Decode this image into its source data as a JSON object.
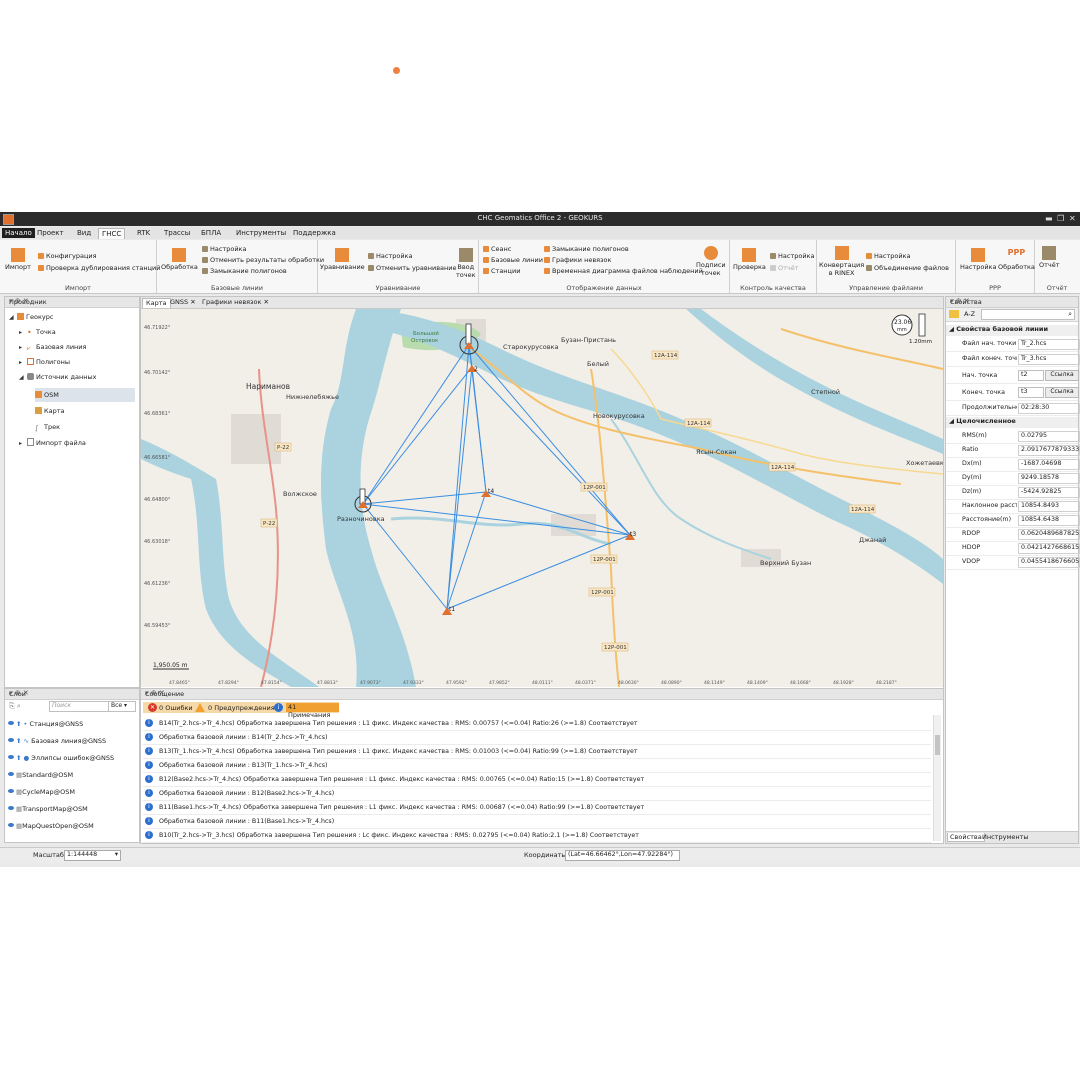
{
  "window": {
    "title": "CHC Geomatics Office 2 - GEOKURS"
  },
  "menu": {
    "items": [
      "Начало",
      "Проект",
      "Вид",
      "ГНСС",
      "RTK",
      "Трассы",
      "БПЛА",
      "Инструменты",
      "Поддержка"
    ],
    "active": "ГНСС"
  },
  "ribbon": {
    "import": {
      "label": "Импорт",
      "big": "Импорт",
      "config": "Конфигурация",
      "dup": "Проверка дублирования станций"
    },
    "baselines": {
      "label": "Базовые линии",
      "big": "Обработка",
      "settings": "Настройка",
      "undo": "Отменить результаты обработки",
      "closure": "Замыкание полигонов"
    },
    "adjust": {
      "label": "Уравнивание",
      "big": "Уравнивание",
      "settings": "Настройка",
      "undo": "Отменить уравнивание",
      "input_line1": "Ввод",
      "input_line2": "точек"
    },
    "display": {
      "label": "Отображение данных",
      "session": "Сеанс",
      "baselines": "Базовые линии",
      "stations": "Станции",
      "closure": "Замыкание полигонов",
      "vectors": "Графики невязок",
      "timeline": "Временная диаграмма файлов наблюдений",
      "captions_line1": "Подписи",
      "captions_line2": "точек"
    },
    "qc": {
      "label": "Контроль качества",
      "check": "Проверка",
      "settings": "Настройка",
      "report": "Отчёт"
    },
    "files": {
      "label": "Управление файлами",
      "convert_line1": "Конвертация",
      "convert_line2": "в RINEX",
      "settings": "Настройка",
      "merge": "Объединение файлов"
    },
    "ppp": {
      "label": "PPP",
      "settings": "Настройка",
      "processing": "Обработка",
      "logo": "PPP"
    },
    "report": {
      "label": "Отчёт",
      "big": "Отчёт"
    }
  },
  "explorer": {
    "title": "Проводник",
    "items": [
      "Геокурс",
      "Точка",
      "Базовая линия",
      "Полигоны",
      "Источник данных",
      "OSM",
      "Карта",
      "Трек",
      "Импорт файла"
    ]
  },
  "map_tabs": [
    "Карта",
    "GNSS",
    "Графики невязок"
  ],
  "map": {
    "labels": {
      "narimanov": "Нариманов",
      "nizhnelebyazhye": "Нижнелебяжье",
      "starokurus": "Старокурусовка",
      "buzan": "Бузан-Пристань",
      "belyi": "Белый",
      "novokurus": "Новокурусовка",
      "volzhskoe": "Волжское",
      "razdorovka": "Разночиновка",
      "yasyn": "Ясын-Сокан",
      "stepnoi": "Степной",
      "hozhetaevka": "Хожетаевка",
      "dzhanai": "Джанай",
      "verkhnii_buzan": "Верхний Бузан",
      "bolshoi_ostrov_1": "Большой",
      "bolshoi_ostrov_2": "Островок"
    },
    "roads": {
      "r22a": "Р-22",
      "r22b": "Р-22",
      "a114_1": "12А-114",
      "a114_2": "12А-114",
      "a114_3": "12А-114",
      "a114_4": "12А-114",
      "p001_1": "12Р-001",
      "p001_2": "12Р-001",
      "p001_3": "12Р-001",
      "p001_4": "12Р-001"
    },
    "lat_ticks": [
      "46.71922°",
      "46.70142°",
      "46.68361°",
      "46.66581°",
      "46.64800°",
      "46.63018°",
      "46.61236°",
      "46.59453°"
    ],
    "lon_ticks": [
      "47.8465°",
      "47.8294°",
      "47.8154°",
      "47.8813°",
      "47.9073°",
      "47.9333°",
      "47.9592°",
      "47.9852°",
      "48.0111°",
      "48.0371°",
      "48.0630°",
      "48.0890°",
      "48.1149°",
      "48.1409°",
      "48.1668°",
      "48.1928°",
      "48.2187°"
    ],
    "scale_text": "1,950.05 m",
    "zoom_text": "23.06",
    "zoom_unit": "mm",
    "bar_text": "1.20mm",
    "points": {
      "t2": "2",
      "t3": "t3",
      "t4": "t4",
      "t1": "t1"
    }
  },
  "properties": {
    "title": "Свойства",
    "tb_sort": "A-Z",
    "section1": "Свойства базовой линии",
    "rows1": [
      {
        "k": "Файл нач. точки",
        "v": "Tr_2.hcs"
      },
      {
        "k": "Файл конеч. точк",
        "v": "Tr_3.hcs"
      },
      {
        "k": "Нач. точка",
        "v": "t2",
        "btn": "Ссылка"
      },
      {
        "k": "Конеч. точка",
        "v": "t3",
        "btn": "Ссылка"
      },
      {
        "k": "Продолжительно",
        "v": "02:28:30"
      }
    ],
    "section2": "Целочисленное",
    "rows2": [
      {
        "k": "RMS(m)",
        "v": "0.02795"
      },
      {
        "k": "Ratio",
        "v": "2.09176778793335"
      },
      {
        "k": "Dx(m)",
        "v": "-1687.04698"
      },
      {
        "k": "Dy(m)",
        "v": "9249.18578"
      },
      {
        "k": "Dz(m)",
        "v": "-5424.92825"
      },
      {
        "k": "Наклонное расст",
        "v": "10854.8493"
      },
      {
        "k": "Расстояние(m)",
        "v": "10854.6438"
      },
      {
        "k": "RDOP",
        "v": "0.0620489687825"
      },
      {
        "k": "HDOP",
        "v": "0.0421427668615"
      },
      {
        "k": "VDOP",
        "v": "0.0455418676605"
      }
    ],
    "tabs": [
      "Свойства",
      "Инструменты"
    ]
  },
  "layers": {
    "title": "Слои",
    "search_placeholder": "Поиск",
    "filter": "Все",
    "items": [
      "Станция@GNSS",
      "Базовая линия@GNSS",
      "Эллипсы ошибок@GNSS",
      "Standard@OSM",
      "CycleMap@OSM",
      "TransportMap@OSM",
      "MapQuestOpen@OSM"
    ]
  },
  "messages": {
    "title": "Сообщение",
    "errors": "0 Ошибки",
    "warnings": "0 Предупреждения",
    "notes": "41 Примечания",
    "rows": [
      "B14(Tr_2.hcs->Tr_4.hcs)  Обработка завершена   Тип решения :   L1 фикс.   Индекс качества : RMS:  0.00757  (<=0.04) Ratio:26  (>=1.8)   Соответствует",
      "Обработка базовой линии :   B14(Tr_2.hcs->Tr_4.hcs)",
      "B13(Tr_1.hcs->Tr_4.hcs)  Обработка завершена   Тип решения :   L1 фикс.   Индекс качества : RMS:  0.01003  (<=0.04) Ratio:99  (>=1.8)   Соответствует",
      "Обработка базовой линии :   B13(Tr_1.hcs->Tr_4.hcs)",
      "B12(Base2.hcs->Tr_4.hcs)  Обработка завершена   Тип решения :   L1 фикс.   Индекс качества : RMS:  0.00765  (<=0.04) Ratio:15  (>=1.8)   Соответствует",
      "Обработка базовой линии :   B12(Base2.hcs->Tr_4.hcs)",
      "B11(Base1.hcs->Tr_4.hcs)  Обработка завершена   Тип решения :   L1 фикс.   Индекс качества : RMS:  0.00687  (<=0.04) Ratio:99  (>=1.8)   Соответствует",
      "Обработка базовой линии :   B11(Base1.hcs->Tr_4.hcs)",
      "B10(Tr_2.hcs->Tr_3.hcs)  Обработка завершена   Тип решения :   Lc фикс.   Индекс качества : RMS:  0.02795  (<=0.04) Ratio:2.1  (>=1.8)   Соответствует"
    ]
  },
  "status": {
    "scale_label": "Масштаб",
    "scale_value": "1:144448",
    "coords_label": "Координаты",
    "coords_value": "(Lat=46.66462°,Lon=47.92284°)"
  },
  "colors": {
    "accent": "#e88b3a",
    "river": "#aad3df",
    "land": "#f2efe9",
    "baseline": "#3a8de0"
  }
}
